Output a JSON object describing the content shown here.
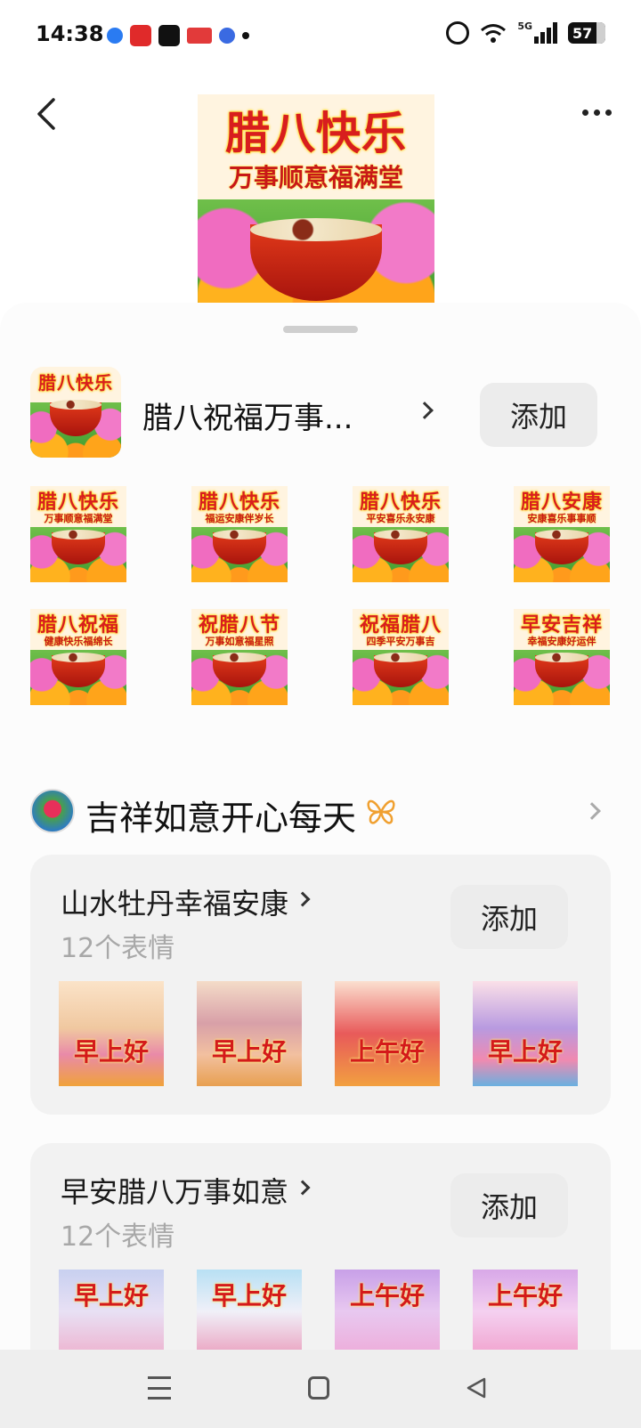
{
  "status_bar": {
    "time": "14:38",
    "network": "5G",
    "battery": "57"
  },
  "header": {
    "hero_title": "腊八快乐",
    "hero_subtitle": "万事顺意福满堂"
  },
  "pack": {
    "icon_text": "腊八快乐",
    "title": "腊八祝福万事...",
    "add_label": "添加",
    "stickers": [
      {
        "title": "腊八快乐",
        "subtitle": "万事顺意福满堂"
      },
      {
        "title": "腊八快乐",
        "subtitle": "福运安康伴岁长"
      },
      {
        "title": "腊八快乐",
        "subtitle": "平安喜乐永安康"
      },
      {
        "title": "腊八安康",
        "subtitle": "安康喜乐事事顺"
      },
      {
        "title": "腊八祝福",
        "subtitle": "健康快乐福绵长"
      },
      {
        "title": "祝腊八节",
        "subtitle": "万事如意福星照"
      },
      {
        "title": "祝福腊八",
        "subtitle": "四季平安万事吉"
      },
      {
        "title": "早安吉祥",
        "subtitle": "幸福安康好运伴"
      }
    ]
  },
  "section": {
    "title": "吉祥如意开心每天"
  },
  "cards": [
    {
      "title": "山水牡丹幸福安康",
      "count": "12个表情",
      "add_label": "添加",
      "thumbs": [
        "早上好",
        "早上好",
        "上午好",
        "早上好"
      ]
    },
    {
      "title": "早安腊八万事如意",
      "count": "12个表情",
      "add_label": "添加",
      "thumbs": [
        "早上好",
        "早上好",
        "上午好",
        "上午好"
      ]
    }
  ]
}
